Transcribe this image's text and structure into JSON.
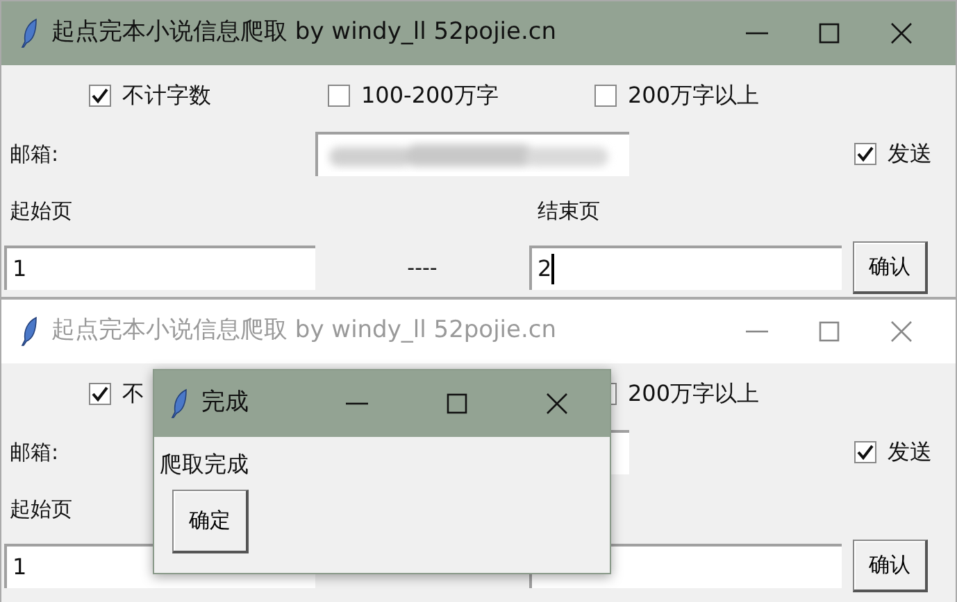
{
  "windows": [
    {
      "title": "起点完本小说信息爬取 by windy_ll 52pojie.cn",
      "active": true,
      "options": [
        {
          "label": "不计字数",
          "checked": true
        },
        {
          "label": "100-200万字",
          "checked": false
        },
        {
          "label": "200万字以上",
          "checked": false
        }
      ],
      "email": {
        "label": "邮箱:",
        "redacted": true
      },
      "send": {
        "label": "发送",
        "checked": true
      },
      "start": {
        "label": "起始页",
        "value": "1"
      },
      "separator": "----",
      "end": {
        "label": "结束页",
        "value": "2",
        "focused": true
      },
      "confirm": "确认"
    },
    {
      "title": "起点完本小说信息爬取 by windy_ll 52pojie.cn",
      "active": false,
      "options": [
        {
          "label": "不",
          "checked": true
        },
        {
          "label": "200万字以上",
          "checked": false
        }
      ],
      "email": {
        "label": "邮箱:"
      },
      "send": {
        "label": "发送",
        "checked": true
      },
      "start": {
        "label": "起始页",
        "value": "1"
      },
      "confirm": "确认"
    }
  ],
  "dialog": {
    "title": "完成",
    "message": "爬取完成",
    "button": "确定"
  }
}
